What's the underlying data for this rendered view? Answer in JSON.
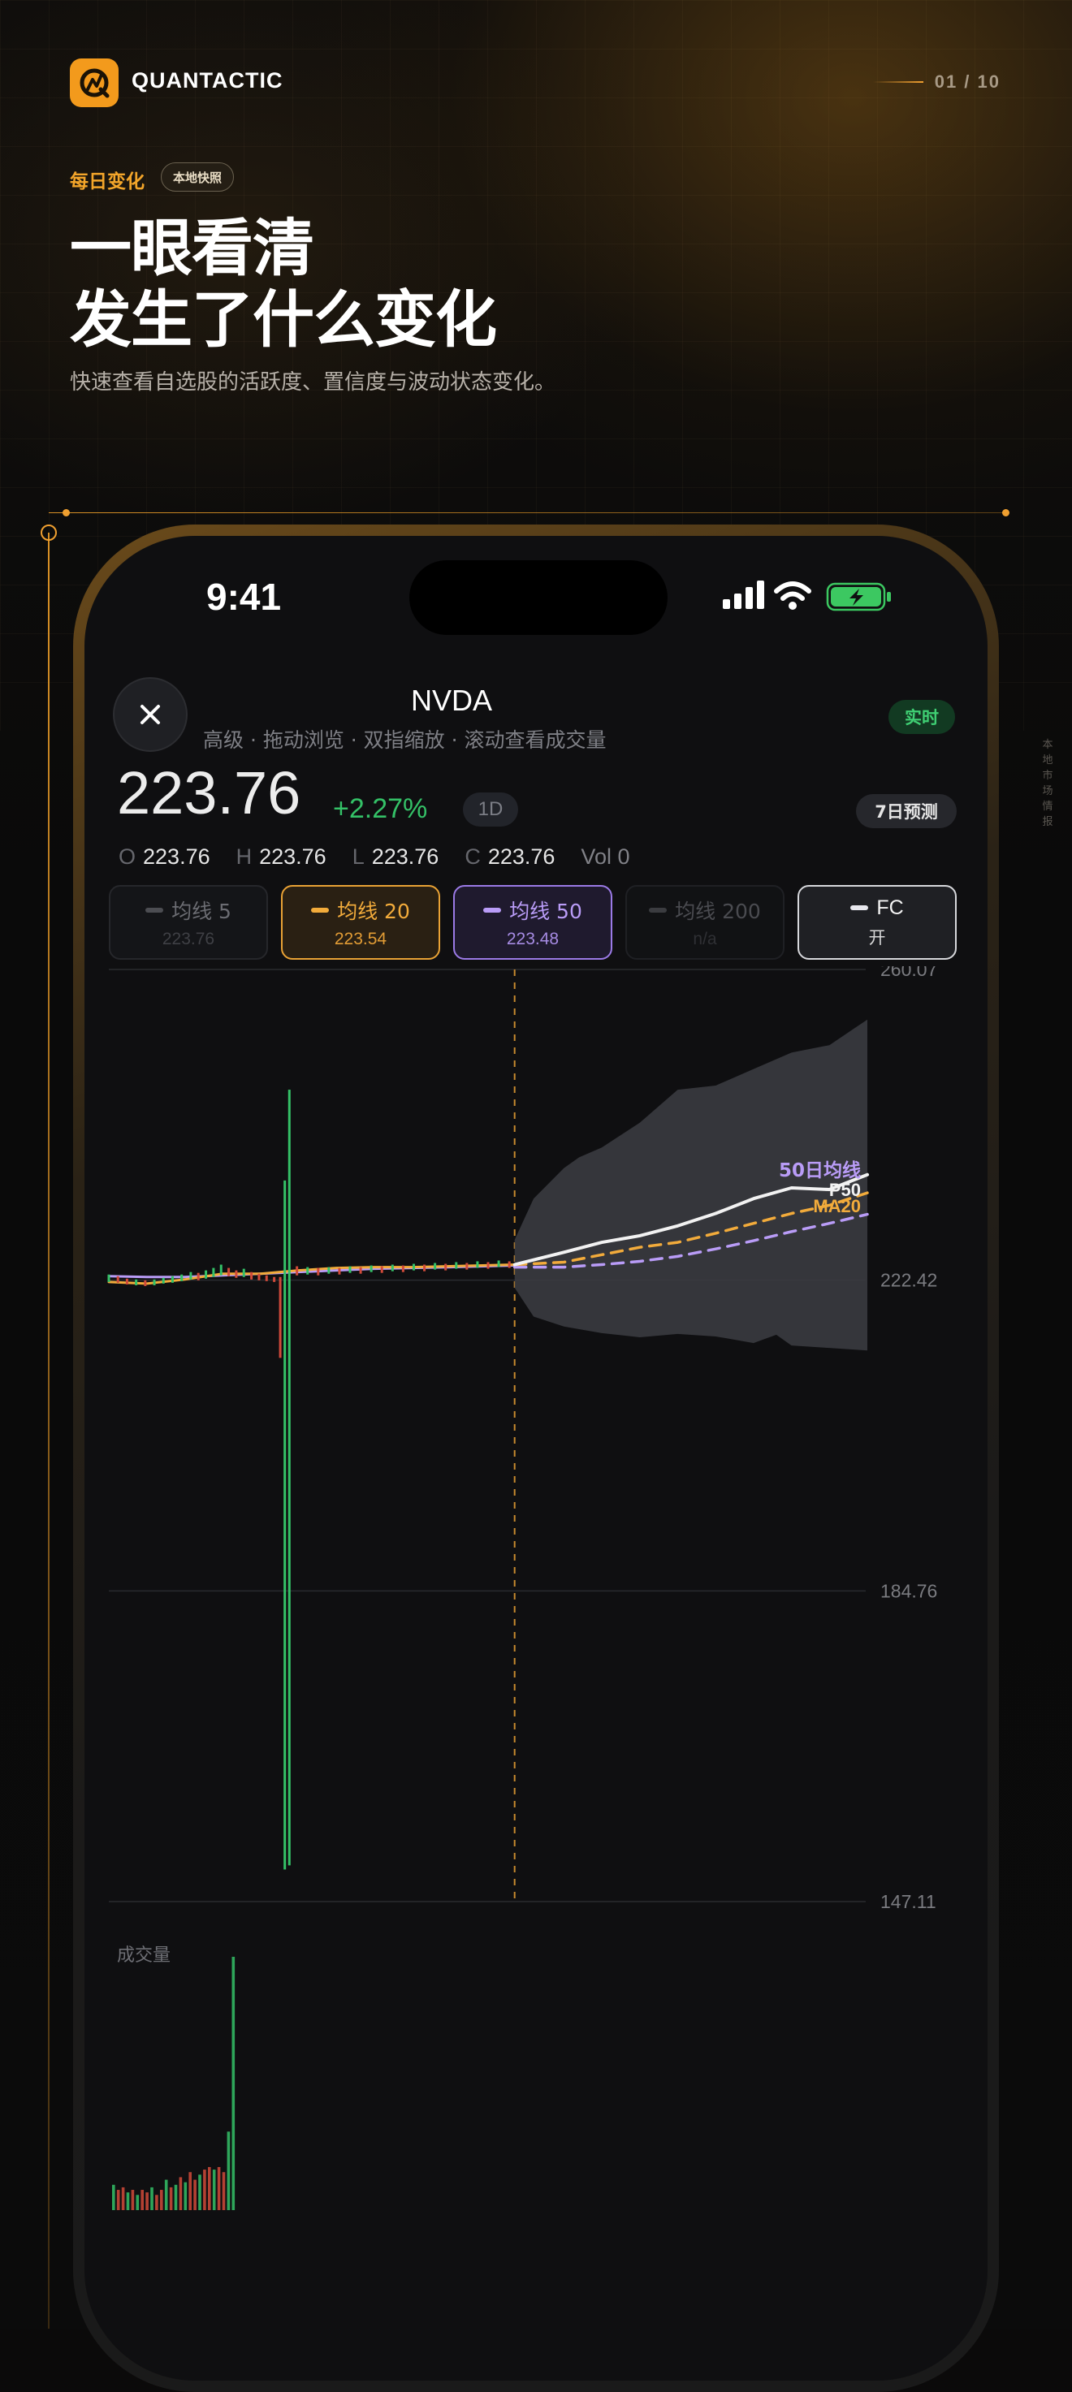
{
  "header": {
    "brand": "QUANTACTIC",
    "pager": "01 / 10",
    "eyebrow": "每日变化",
    "tag": "本地快照",
    "headline_line1": "一眼看清",
    "headline_line2": "发生了什么变化",
    "subtitle": "快速查看自选股的活跃度、置信度与波动状态变化。",
    "side_caption": "本地市场情报"
  },
  "status_bar": {
    "time": "9:41"
  },
  "stock": {
    "ticker": "NVDA",
    "subtitle": "高级 · 拖动浏览 · 双指缩放 · 滚动查看成交量",
    "live_badge": "实时",
    "price": "223.76",
    "change": "+2.27%",
    "timeframe": "1D",
    "forecast_badge": "7日预测",
    "ohlc": {
      "o_label": "O",
      "o": "223.76",
      "h_label": "H",
      "h": "223.76",
      "l_label": "L",
      "l": "223.76",
      "c_label": "C",
      "c": "223.76",
      "vol": "Vol 0"
    }
  },
  "chips": [
    {
      "label": "均线 5",
      "value": "223.76",
      "state": "off"
    },
    {
      "label": "均线 20",
      "value": "223.54",
      "state": "on"
    },
    {
      "label": "均线 50",
      "value": "223.48",
      "state": "on"
    },
    {
      "label": "均线 200",
      "value": "n/a",
      "state": "disabled"
    },
    {
      "label": "FC",
      "value": "开",
      "state": "on"
    }
  ],
  "colors": {
    "accent": "#f39a1c",
    "up": "#34c167",
    "down": "#d14a3a",
    "ma20": "#f2ab3b",
    "ma50": "#b99cf7",
    "forecast": "#f2f2f2"
  },
  "chart_data": {
    "type": "line",
    "y_ticks": [
      "260.07",
      "222.42",
      "184.76",
      "147.11"
    ],
    "ylim": [
      147.11,
      260.07
    ],
    "series_labels": {
      "ma50": "50日均线",
      "p50": "P50",
      "ma20": "MA20"
    },
    "forecast_start": 0.535,
    "candles": [
      [
        0.0,
        223.1,
        222.2
      ],
      [
        0.012,
        222.9,
        222.1
      ],
      [
        0.024,
        222.6,
        221.9
      ],
      [
        0.036,
        222.5,
        221.8
      ],
      [
        0.048,
        222.4,
        221.7
      ],
      [
        0.06,
        222.5,
        221.8
      ],
      [
        0.072,
        222.7,
        222.0
      ],
      [
        0.084,
        222.9,
        222.1
      ],
      [
        0.096,
        223.1,
        222.3
      ],
      [
        0.108,
        223.4,
        222.5
      ],
      [
        0.118,
        223.3,
        222.4
      ],
      [
        0.128,
        223.6,
        222.6
      ],
      [
        0.138,
        223.9,
        222.8
      ],
      [
        0.148,
        224.3,
        223.0
      ],
      [
        0.158,
        223.9,
        222.9
      ],
      [
        0.168,
        223.6,
        222.7
      ],
      [
        0.178,
        223.8,
        222.8
      ],
      [
        0.188,
        223.4,
        222.5
      ],
      [
        0.198,
        223.2,
        222.4
      ],
      [
        0.208,
        223.0,
        222.3
      ],
      [
        0.218,
        222.8,
        222.2
      ],
      [
        0.226,
        222.8,
        213.0
      ],
      [
        0.232,
        234.5,
        151.0
      ],
      [
        0.238,
        245.5,
        151.5
      ],
      [
        0.248,
        224.1,
        223.0
      ],
      [
        0.262,
        224.0,
        223.1
      ],
      [
        0.276,
        223.9,
        223.0
      ],
      [
        0.29,
        224.0,
        223.2
      ],
      [
        0.304,
        223.9,
        223.1
      ],
      [
        0.318,
        224.1,
        223.3
      ],
      [
        0.332,
        224.0,
        223.2
      ],
      [
        0.346,
        224.2,
        223.4
      ],
      [
        0.36,
        224.1,
        223.3
      ],
      [
        0.374,
        224.3,
        223.5
      ],
      [
        0.388,
        224.2,
        223.4
      ],
      [
        0.402,
        224.4,
        223.6
      ],
      [
        0.416,
        224.3,
        223.5
      ],
      [
        0.43,
        224.5,
        223.7
      ],
      [
        0.444,
        224.4,
        223.6
      ],
      [
        0.458,
        224.6,
        223.8
      ],
      [
        0.472,
        224.5,
        223.7
      ],
      [
        0.486,
        224.7,
        223.9
      ],
      [
        0.5,
        224.6,
        223.8
      ],
      [
        0.514,
        224.8,
        224.0
      ],
      [
        0.528,
        224.7,
        223.9
      ]
    ],
    "candle_colors": [
      "up",
      "down",
      "down",
      "up",
      "down",
      "up",
      "up",
      "up",
      "up",
      "up",
      "down",
      "up",
      "up",
      "up",
      "down",
      "down",
      "up",
      "down",
      "down",
      "down",
      "down",
      "down",
      "up",
      "up",
      "down",
      "up",
      "down",
      "up",
      "down",
      "up",
      "down",
      "up",
      "down",
      "up",
      "down",
      "up",
      "down",
      "up",
      "down",
      "up",
      "down",
      "up",
      "down",
      "up",
      "down"
    ],
    "ma20": [
      [
        0.0,
        222.2
      ],
      [
        0.05,
        222.0
      ],
      [
        0.1,
        222.5
      ],
      [
        0.15,
        223.2
      ],
      [
        0.2,
        223.2
      ],
      [
        0.25,
        223.6
      ],
      [
        0.3,
        223.9
      ],
      [
        0.35,
        224.0
      ],
      [
        0.4,
        224.0
      ],
      [
        0.45,
        224.1
      ],
      [
        0.535,
        224.3
      ]
    ],
    "ma50": [
      [
        0.0,
        222.9
      ],
      [
        0.05,
        222.8
      ],
      [
        0.1,
        222.8
      ],
      [
        0.15,
        223.0
      ],
      [
        0.2,
        223.2
      ],
      [
        0.25,
        223.4
      ],
      [
        0.3,
        223.6
      ],
      [
        0.35,
        223.8
      ],
      [
        0.4,
        223.9
      ],
      [
        0.45,
        224.0
      ],
      [
        0.535,
        224.2
      ]
    ],
    "forecast_p50": [
      [
        0.535,
        224.3
      ],
      [
        0.6,
        225.8
      ],
      [
        0.65,
        227.0
      ],
      [
        0.7,
        227.8
      ],
      [
        0.75,
        229.0
      ],
      [
        0.8,
        230.5
      ],
      [
        0.85,
        232.3
      ],
      [
        0.9,
        233.6
      ],
      [
        0.95,
        233.4
      ],
      [
        1.0,
        235.2
      ]
    ],
    "forecast_ma20": [
      [
        0.535,
        224.3
      ],
      [
        0.6,
        224.6
      ],
      [
        0.65,
        225.5
      ],
      [
        0.7,
        226.4
      ],
      [
        0.75,
        227.0
      ],
      [
        0.8,
        228.1
      ],
      [
        0.85,
        229.3
      ],
      [
        0.9,
        230.5
      ],
      [
        0.95,
        231.5
      ],
      [
        1.0,
        233.0
      ]
    ],
    "forecast_ma50": [
      [
        0.535,
        224.0
      ],
      [
        0.6,
        224.0
      ],
      [
        0.65,
        224.3
      ],
      [
        0.7,
        224.7
      ],
      [
        0.75,
        225.3
      ],
      [
        0.8,
        226.2
      ],
      [
        0.85,
        227.2
      ],
      [
        0.9,
        228.3
      ],
      [
        0.95,
        229.3
      ],
      [
        1.0,
        230.4
      ]
    ],
    "band_upper": [
      [
        0.535,
        227.3
      ],
      [
        0.56,
        232.3
      ],
      [
        0.6,
        236.0
      ],
      [
        0.62,
        237.3
      ],
      [
        0.65,
        238.5
      ],
      [
        0.7,
        241.5
      ],
      [
        0.75,
        245.5
      ],
      [
        0.8,
        246.0
      ],
      [
        0.85,
        248.0
      ],
      [
        0.9,
        250.0
      ],
      [
        0.95,
        250.9
      ],
      [
        1.0,
        254.0
      ]
    ],
    "band_lower": [
      [
        0.535,
        221.5
      ],
      [
        0.56,
        218.0
      ],
      [
        0.6,
        216.8
      ],
      [
        0.65,
        216.0
      ],
      [
        0.7,
        215.5
      ],
      [
        0.75,
        215.9
      ],
      [
        0.8,
        215.6
      ],
      [
        0.85,
        214.8
      ],
      [
        0.88,
        215.8
      ],
      [
        0.9,
        214.5
      ],
      [
        0.95,
        214.2
      ],
      [
        1.0,
        213.9
      ]
    ],
    "volume_label": "成交量",
    "volume": [
      0.1,
      0.08,
      0.09,
      0.07,
      0.08,
      0.06,
      0.08,
      0.07,
      0.09,
      0.06,
      0.08,
      0.12,
      0.09,
      0.1,
      0.13,
      0.11,
      0.15,
      0.12,
      0.14,
      0.16,
      0.17,
      0.16,
      0.17,
      0.15,
      0.31,
      1.0
    ],
    "volume_colors": [
      "up",
      "down",
      "down",
      "up",
      "down",
      "up",
      "down",
      "down",
      "up",
      "down",
      "down",
      "up",
      "down",
      "up",
      "down",
      "up",
      "down",
      "down",
      "up",
      "down",
      "down",
      "up",
      "down",
      "down",
      "up",
      "up"
    ]
  }
}
